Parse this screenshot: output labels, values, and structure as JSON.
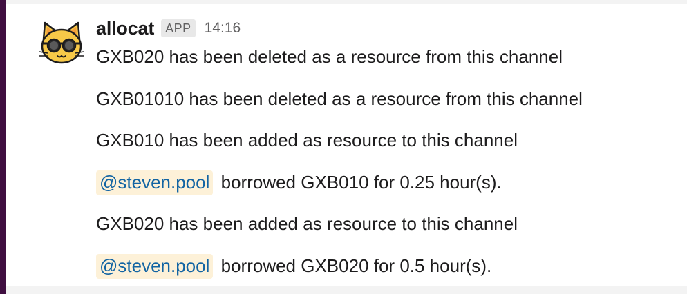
{
  "message": {
    "sender": "allocat",
    "badge": "APP",
    "timestamp": "14:16",
    "avatar_icon": "cat-with-sunglasses-icon",
    "lines": [
      {
        "text": "GXB020 has been deleted as a resource from this channel"
      },
      {
        "text": "GXB01010 has been deleted as a resource from this channel"
      },
      {
        "text": "GXB010 has been added as resource to this channel"
      },
      {
        "mention": "@steven.pool",
        "text": "borrowed GXB010 for 0.25 hour(s)."
      },
      {
        "text": "GXB020 has been added as resource to this channel"
      },
      {
        "mention": "@steven.pool",
        "text": "borrowed GXB020 for 0.5 hour(s)."
      }
    ]
  },
  "colors": {
    "sidebar": "#3f0e40",
    "mention_bg": "#fdf1d8",
    "mention_text": "#1264a3",
    "avatar_fill": "#f7c948"
  }
}
